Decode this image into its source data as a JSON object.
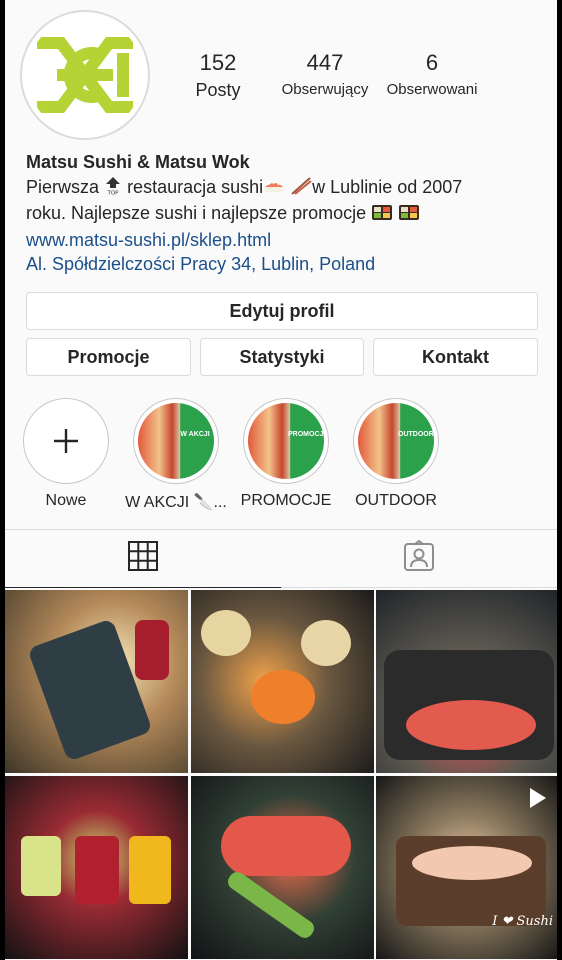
{
  "profile": {
    "stats": [
      {
        "value": "152",
        "label": "Posty"
      },
      {
        "value": "447",
        "label": "Obserwujący"
      },
      {
        "value": "6",
        "label": "Obserwowani"
      }
    ],
    "name": "Matsu Sushi & Matsu Wok",
    "bio_line1_a": "Pierwsza",
    "bio_line1_b": "restauracja sushi",
    "bio_line1_c": "w Lublinie od 2007",
    "bio_line2": "roku. Najlepsze sushi i najlepsze promocje",
    "link": "www.matsu-sushi.pl/sklep.html",
    "address": "Al. Spółdzielczości Pracy 34, Lublin, Poland",
    "brand_color": "#b5d334"
  },
  "buttons": {
    "edit": "Edytuj profil",
    "promo": "Promocje",
    "stats": "Statystyki",
    "contact": "Kontakt"
  },
  "highlights": [
    {
      "label": "Nowe",
      "icon": "plus-icon"
    },
    {
      "label": "W AKCJI 🔪...",
      "tag": "W AKCJI"
    },
    {
      "label": "PROMOCJE",
      "tag": "PROMOCJE"
    },
    {
      "label": "OUTDOOR",
      "tag": "OUTDOOR"
    }
  ],
  "tabs": [
    {
      "icon": "grid-icon",
      "active": true
    },
    {
      "icon": "tagged-icon",
      "active": false
    }
  ],
  "posts": [
    {
      "subject": "phone-with-sushi-photo"
    },
    {
      "subject": "sushi-platter"
    },
    {
      "subject": "sushi-trays"
    },
    {
      "subject": "drinks"
    },
    {
      "subject": "sushi-rolls"
    },
    {
      "subject": "sushi-board",
      "video": true,
      "watermark": "I ❤ Sushi"
    }
  ],
  "colors": {
    "text": "#262626",
    "link": "#1b4f8a",
    "border": "#dbdbdb",
    "highlight_green": "#2aa14a"
  }
}
